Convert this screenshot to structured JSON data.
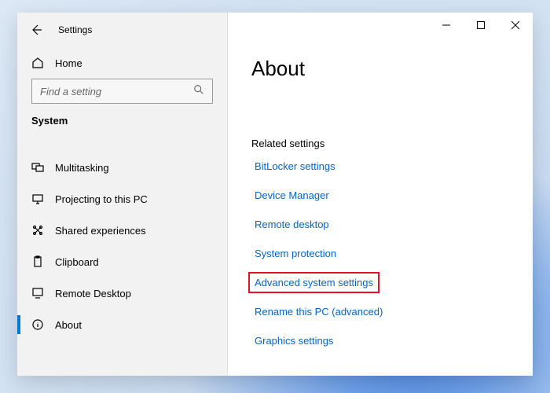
{
  "header": {
    "title": "Settings"
  },
  "sidebar": {
    "home_label": "Home",
    "search_placeholder": "Find a setting",
    "section_label": "System",
    "items": [
      {
        "label": "Multitasking"
      },
      {
        "label": "Projecting to this PC"
      },
      {
        "label": "Shared experiences"
      },
      {
        "label": "Clipboard"
      },
      {
        "label": "Remote Desktop"
      },
      {
        "label": "About"
      }
    ]
  },
  "main": {
    "page_title": "About",
    "related_label": "Related settings",
    "links": [
      {
        "label": "BitLocker settings"
      },
      {
        "label": "Device Manager"
      },
      {
        "label": "Remote desktop"
      },
      {
        "label": "System protection"
      },
      {
        "label": "Advanced system settings"
      },
      {
        "label": "Rename this PC (advanced)"
      },
      {
        "label": "Graphics settings"
      }
    ]
  }
}
